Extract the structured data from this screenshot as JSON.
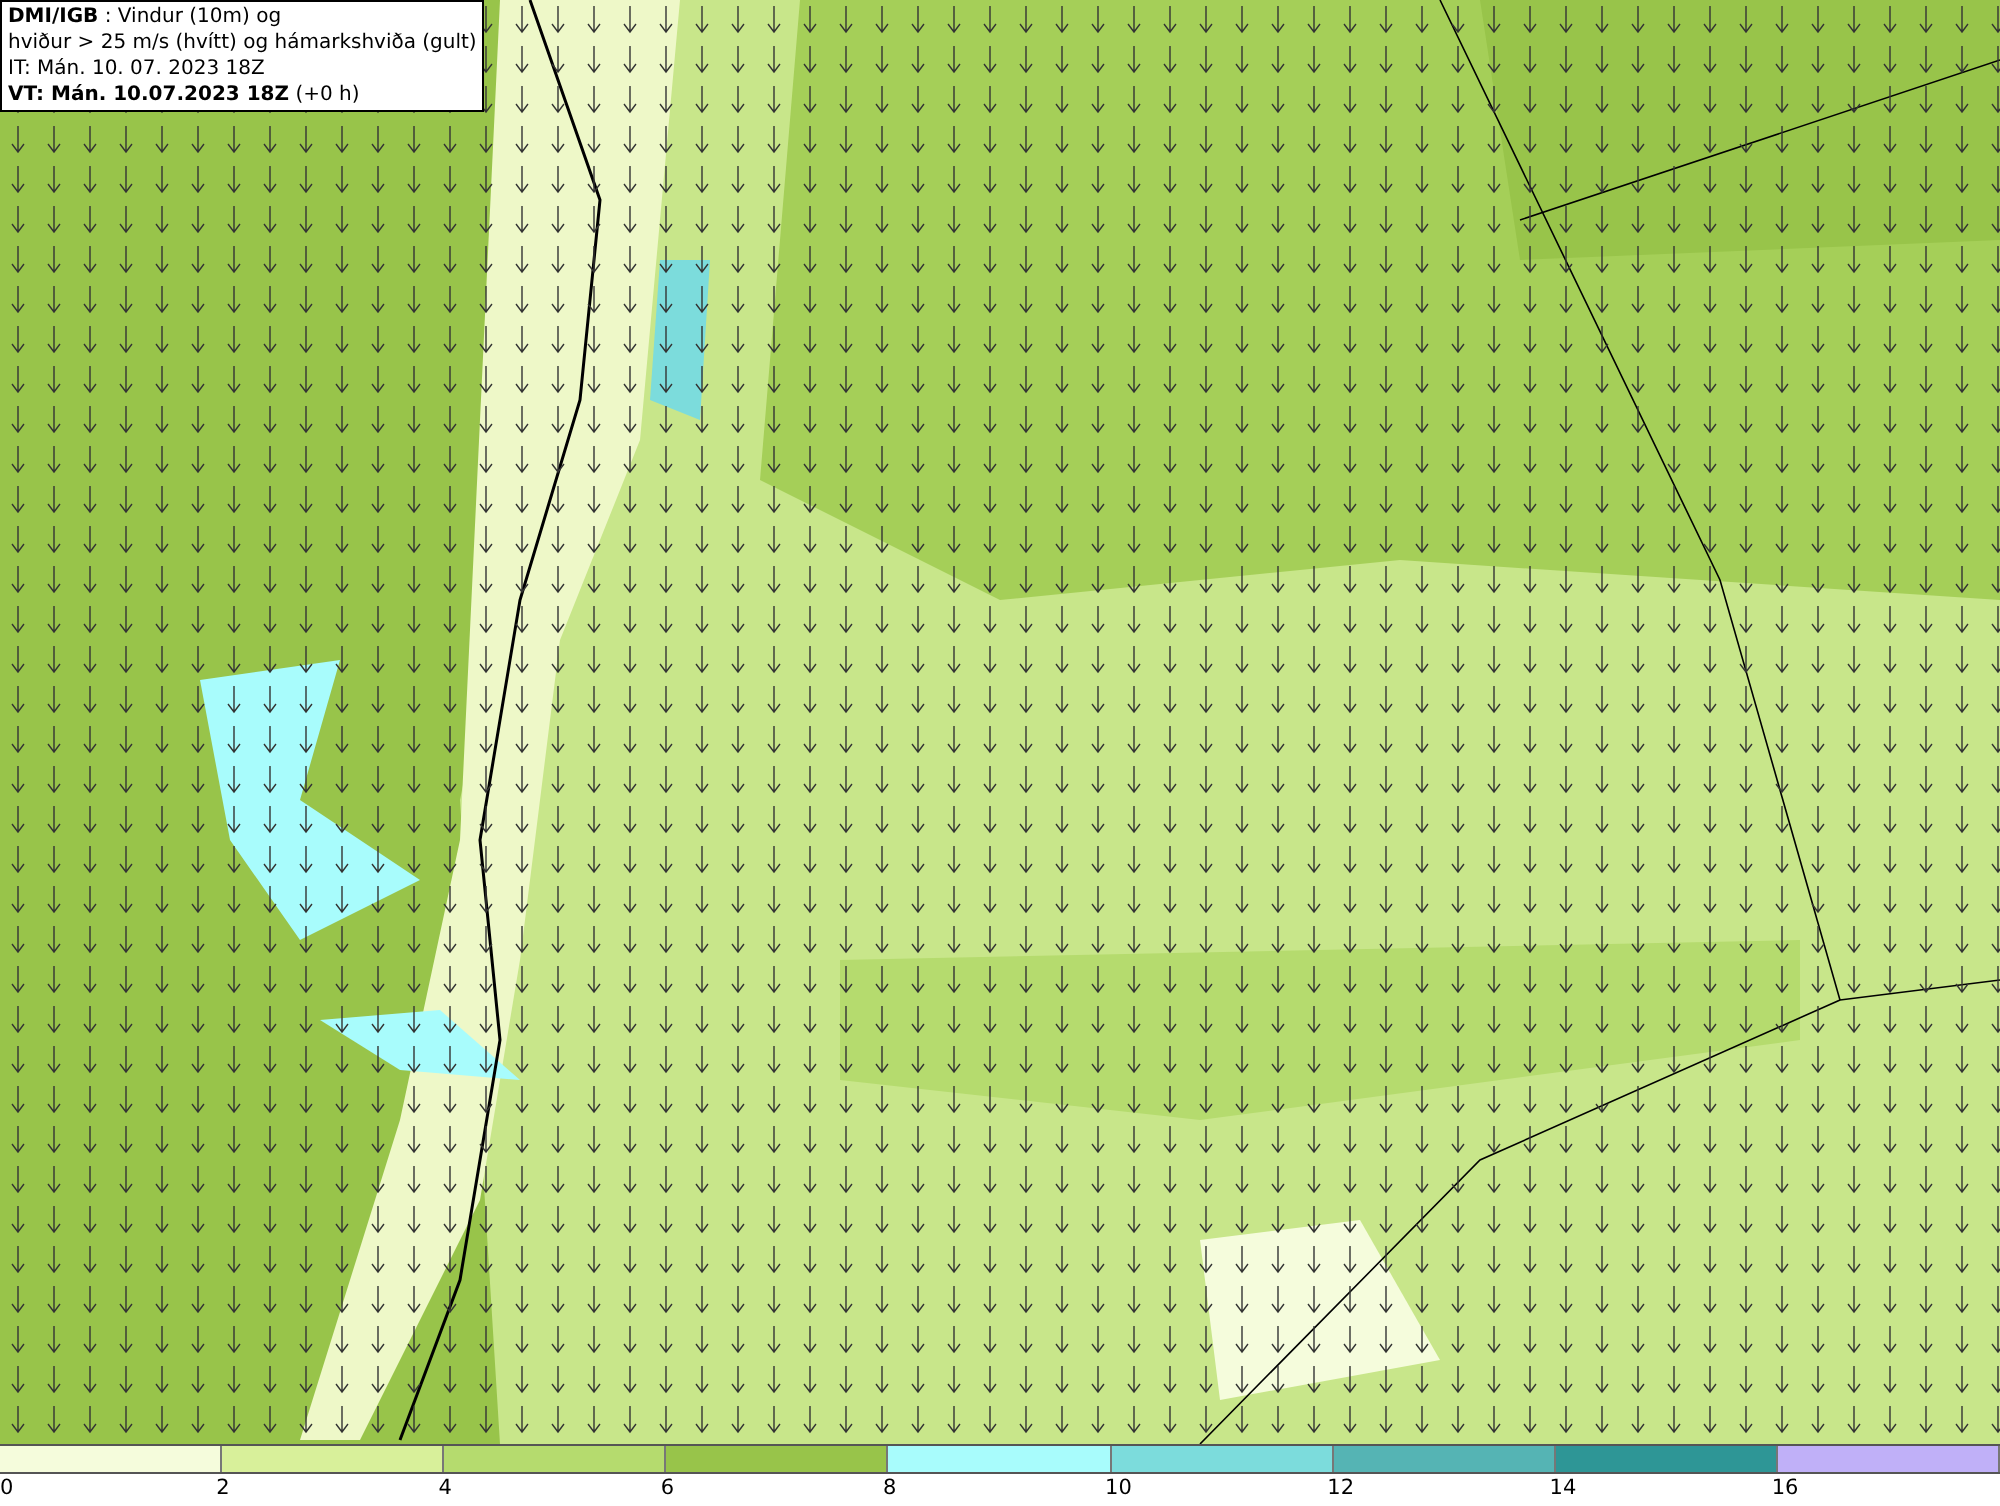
{
  "info_box": {
    "lines": [
      "**DMI/IGB** : Vindur (10m) og",
      "hviður > 25 m/s (hvítt) og hámarkshviða (gult)",
      "IT: Mán. 10. 07. 2023 18Z",
      "**VT: Mán. 10.07.2023 18Z** (+0 h)"
    ]
  },
  "color_scale": {
    "segments": [
      {
        "color": "#f5fcdc"
      },
      {
        "color": "#d8f09a"
      },
      {
        "color": "#b5db6e"
      },
      {
        "color": "#98c44a"
      },
      {
        "color": "#a8fcfc"
      },
      {
        "color": "#7cdcdc"
      },
      {
        "color": "#55b4b4"
      },
      {
        "color": "#2e9696"
      },
      {
        "color": "#c0b0f8"
      }
    ],
    "ticks": [
      "0",
      "2",
      "4",
      "6",
      "8",
      "10",
      "12",
      "14",
      "16"
    ]
  }
}
